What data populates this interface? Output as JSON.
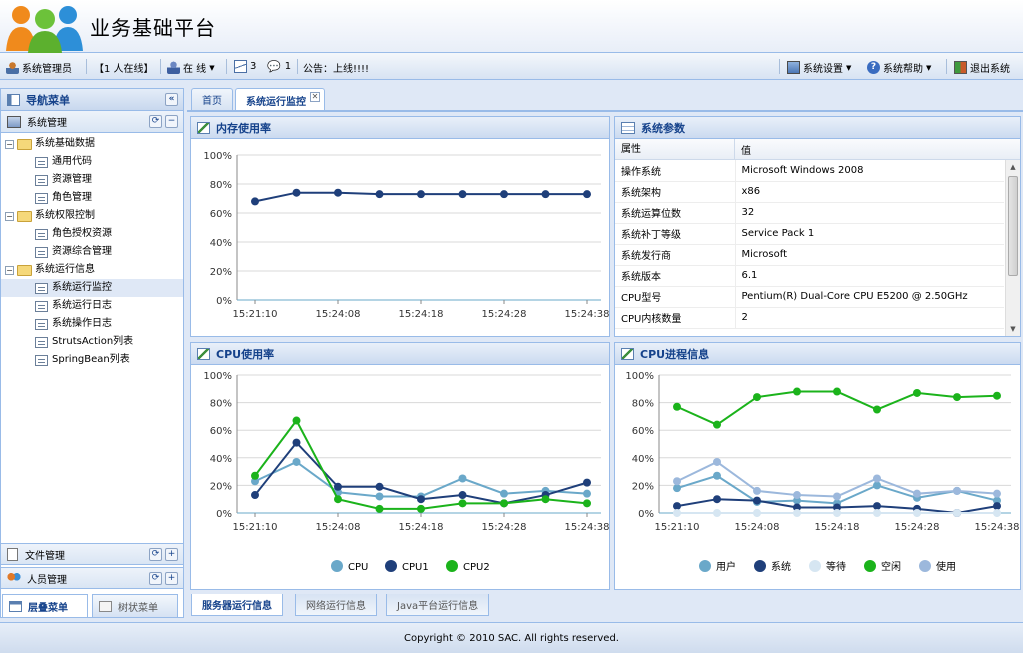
{
  "app": {
    "title": "业务基础平台",
    "copyright": "Copyright © 2010 SAC. All rights reserved."
  },
  "toolbar": {
    "user": "系统管理员",
    "online_count": "【1 人在线】",
    "status": "在 线",
    "mail_count": "3",
    "msg_count": "1",
    "notice": "公告：上线!!!!",
    "settings": "系统设置",
    "help": "系统帮助",
    "logout": "退出系统"
  },
  "west": {
    "title": "导航菜单",
    "sections": [
      {
        "label": "系统管理"
      },
      {
        "label": "文件管理"
      },
      {
        "label": "人员管理"
      }
    ],
    "tree": [
      {
        "label": "系统基础数据",
        "type": "folder"
      },
      {
        "label": "通用代码",
        "type": "leaf"
      },
      {
        "label": "资源管理",
        "type": "leaf"
      },
      {
        "label": "角色管理",
        "type": "leaf"
      },
      {
        "label": "系统权限控制",
        "type": "folder"
      },
      {
        "label": "角色授权资源",
        "type": "leaf"
      },
      {
        "label": "资源综合管理",
        "type": "leaf"
      },
      {
        "label": "系统运行信息",
        "type": "folder"
      },
      {
        "label": "系统运行监控",
        "type": "leaf"
      },
      {
        "label": "系统运行日志",
        "type": "leaf"
      },
      {
        "label": "系统操作日志",
        "type": "leaf"
      },
      {
        "label": "StrutsAction列表",
        "type": "leaf"
      },
      {
        "label": "SpringBean列表",
        "type": "leaf"
      }
    ],
    "bottom_tabs": [
      "层叠菜单",
      "树状菜单"
    ]
  },
  "tabs": [
    "首页",
    "系统运行监控"
  ],
  "bottom_tabs": [
    "服务器运行信息",
    "网络运行信息",
    "Java平台运行信息"
  ],
  "panels": {
    "memory": {
      "title": "内存使用率"
    },
    "params": {
      "title": "系统参数",
      "columns": [
        "属性",
        "值"
      ],
      "rows": [
        [
          "操作系统",
          "Microsoft Windows 2008"
        ],
        [
          "系统架构",
          "x86"
        ],
        [
          "系统运算位数",
          "32"
        ],
        [
          "系统补丁等级",
          "Service Pack 1"
        ],
        [
          "系统发行商",
          "Microsoft"
        ],
        [
          "系统版本",
          "6.1"
        ],
        [
          "CPU型号",
          "Pentium(R) Dual-Core CPU E5200 @ 2.50GHz"
        ],
        [
          "CPU内核数量",
          "2"
        ]
      ]
    },
    "cpu": {
      "title": "CPU使用率"
    },
    "cpuproc": {
      "title": "CPU进程信息"
    }
  },
  "chart_data": [
    {
      "type": "line",
      "y_ticks": [
        "0%",
        "20%",
        "40%",
        "60%",
        "80%",
        "100%"
      ],
      "ylim": [
        0,
        100
      ],
      "x_ticks": [
        "15:21:10",
        "15:24:08",
        "15:24:18",
        "15:24:28",
        "15:24:38"
      ],
      "series": [
        {
          "color": "#1f3f7a",
          "values": [
            68,
            74,
            74,
            73,
            73,
            73,
            73,
            73,
            73
          ]
        }
      ]
    },
    {
      "type": "line",
      "y_ticks": [
        "0%",
        "20%",
        "40%",
        "60%",
        "80%",
        "100%"
      ],
      "ylim": [
        0,
        100
      ],
      "x_ticks": [
        "15:21:10",
        "15:24:08",
        "15:24:18",
        "15:24:28",
        "15:24:38"
      ],
      "series": [
        {
          "name": "CPU",
          "color": "#6aa8c9",
          "values": [
            23,
            37,
            15,
            12,
            12,
            25,
            14,
            16,
            14
          ]
        },
        {
          "name": "CPU1",
          "color": "#1f3f7a",
          "values": [
            13,
            51,
            19,
            19,
            10,
            13,
            7,
            13,
            22
          ]
        },
        {
          "name": "CPU2",
          "color": "#1bb31b",
          "values": [
            27,
            67,
            10,
            3,
            3,
            7,
            7,
            10,
            7
          ]
        }
      ]
    },
    {
      "type": "line",
      "y_ticks": [
        "0%",
        "20%",
        "40%",
        "60%",
        "80%",
        "100%"
      ],
      "ylim": [
        0,
        100
      ],
      "x_ticks": [
        "15:21:10",
        "15:24:08",
        "15:24:18",
        "15:24:28",
        "15:24:38"
      ],
      "series": [
        {
          "name": "用户",
          "color": "#6aa8c9",
          "values": [
            18,
            27,
            8,
            9,
            7,
            20,
            11,
            16,
            9
          ]
        },
        {
          "name": "系统",
          "color": "#1f3f7a",
          "values": [
            5,
            10,
            9,
            4,
            4,
            5,
            3,
            0,
            5
          ]
        },
        {
          "name": "等待",
          "color": "#d6e6f2",
          "values": [
            0,
            0,
            0,
            0,
            0,
            0,
            0,
            0,
            0
          ]
        },
        {
          "name": "空闲",
          "color": "#1bb31b",
          "values": [
            77,
            64,
            84,
            88,
            88,
            75,
            87,
            84,
            85
          ]
        },
        {
          "name": "使用",
          "color": "#9cb8dc",
          "values": [
            23,
            37,
            16,
            13,
            12,
            25,
            14,
            16,
            14
          ]
        }
      ]
    }
  ]
}
